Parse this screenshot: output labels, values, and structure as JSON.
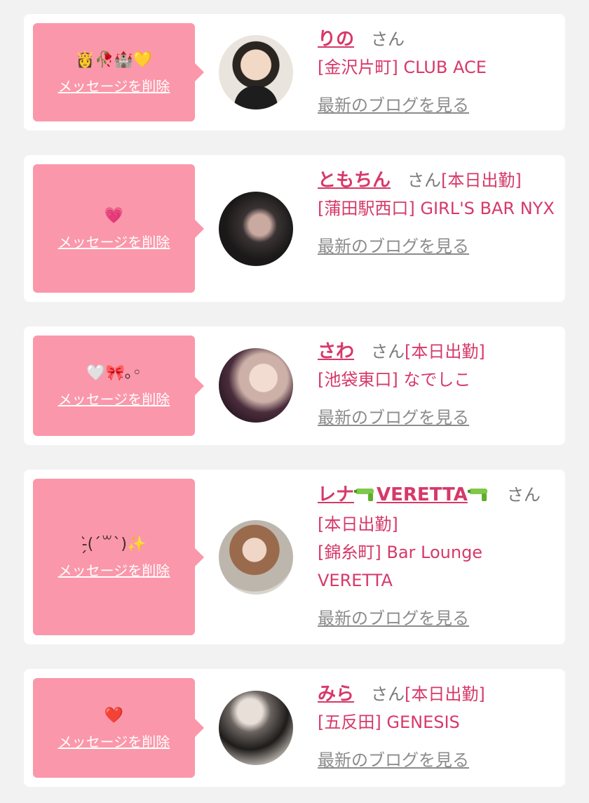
{
  "cards": [
    {
      "message": "👸🥀🏰💛",
      "delete_label": "メッセージを削除",
      "name": "りの",
      "honorific": "さん",
      "attendance": "",
      "shop": "[金沢片町] CLUB ACE",
      "blog_label": "最新のブログを見る"
    },
    {
      "message": "💗",
      "delete_label": "メッセージを削除",
      "name": "ともちん",
      "honorific": "さん",
      "attendance": "[本日出勤]",
      "shop": "[蒲田駅西口] GIRL'S BAR NYX",
      "blog_label": "最新のブログを見る"
    },
    {
      "message": "🤍🎀｡◦",
      "delete_label": "メッセージを削除",
      "name": "さわ",
      "honorific": "さん",
      "attendance": "[本日出勤]",
      "shop": "[池袋東口] なでしこ",
      "blog_label": "最新のブログを見る"
    },
    {
      "message": "-̗̀(ˊ꒳ˋ)✨",
      "delete_label": "メッセージを削除",
      "name_prefix": "レナ",
      "name_middle": "VERETTA",
      "honorific": "さん",
      "attendance": "[本日出勤]",
      "shop": "[錦糸町] Bar Lounge VERETTA",
      "blog_label": "最新のブログを見る"
    },
    {
      "message": "❤️",
      "delete_label": "メッセージを削除",
      "name": "みら",
      "honorific": "さん",
      "attendance": "[本日出勤]",
      "shop": "[五反田] GENESIS",
      "blog_label": "最新のブログを見る"
    }
  ]
}
